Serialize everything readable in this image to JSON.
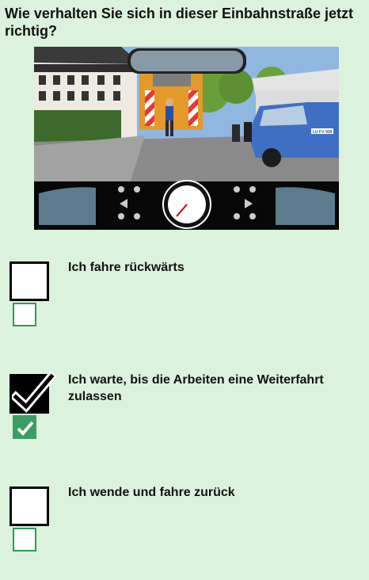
{
  "question": "Wie verhalten Sie sich in dieser Einbahnstraße jetzt richtig?",
  "scene": {
    "description_icon": "driving-scene-image",
    "license_plate": "LU·FV·999"
  },
  "answers": [
    {
      "text": "Ich fahre rückwärts",
      "checked": false
    },
    {
      "text": "Ich warte, bis die Arbeiten eine Weiterfahrt zulassen",
      "checked": true
    },
    {
      "text": "Ich wende und fahre zurück",
      "checked": false
    }
  ],
  "colors": {
    "background": "#dbf3dc",
    "check_green": "#3a9e62",
    "box_border_green": "#2e9a58"
  }
}
